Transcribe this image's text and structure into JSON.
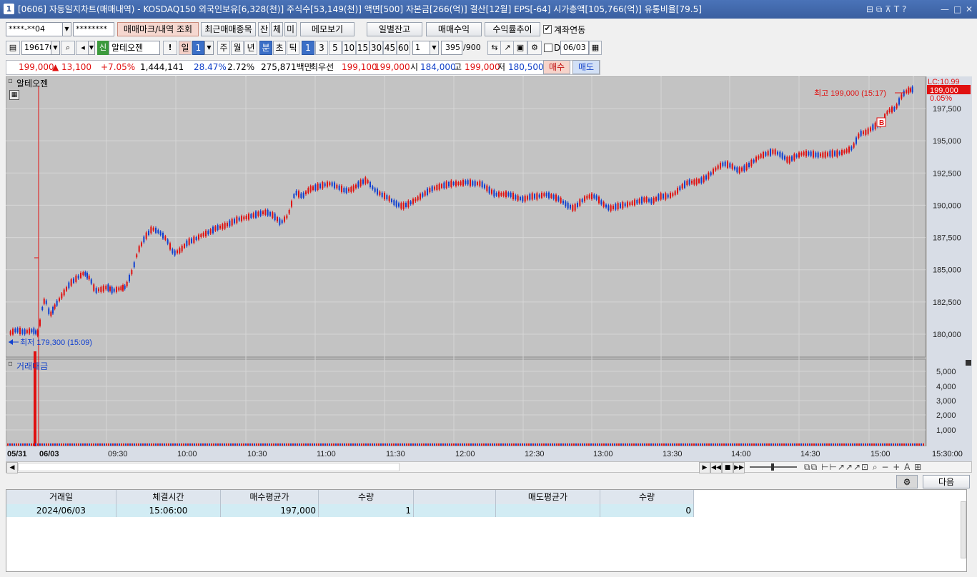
{
  "window": {
    "title": "[0606] 자동일지차트(매매내역) - KOSDAQ150 외국인보유[6,328(천)] 주식수[53,149(천)] 액면[500] 자본금[266(억)] 결산[12월] EPS[-64] 시가총액[105,766(억)] 유통비율[79.5]",
    "num": "1",
    "ctrl_icons": "⊟ ⧉ ⊼ T ?",
    "min": "—",
    "max": "□",
    "close": "✕"
  },
  "account": {
    "number": "****-**04",
    "password": "********"
  },
  "toolbar": {
    "btn_mark": "매매마크/내역 조회",
    "btn_recent": "최근매매종목",
    "btn_jan": "잔",
    "btn_che": "체",
    "btn_mi": "미",
    "btn_memo": "메모보기",
    "btn_daily": "일별잔고",
    "btn_profit": "매매수익",
    "btn_rate": "수익률추이",
    "chk_link": "계좌연동"
  },
  "toolbar2": {
    "code": "196170",
    "sin": "신",
    "name": "알테오젠",
    "excl": "!",
    "il": "일",
    "il_val": "1",
    "ju": "주",
    "wol": "월",
    "nyeon": "년",
    "bun": "분",
    "cho": "초",
    "tik": "틱",
    "m1": "1",
    "m3": "3",
    "m5": "5",
    "m10": "10",
    "m15": "15",
    "m30": "30",
    "m45": "45",
    "m60": "60",
    "interval": "1",
    "count": "395",
    "count_max": "/900",
    "d_label": "D",
    "date": "06/03"
  },
  "quote": {
    "price": "199,000",
    "change": "▲  13,100",
    "pct": "+7.05%",
    "volume": "1,444,141",
    "rate1": "28.47%",
    "rate2": "2.72%",
    "amount": "275,871백만",
    "best_label": "최우선",
    "best_ask": "199,100",
    "best_bid": "199,000",
    "open_label": "시",
    "open": "184,000",
    "high_label": "고",
    "high": "199,000",
    "low_label": "저",
    "low": "180,500",
    "buy": "매수",
    "sell": "매도"
  },
  "chart": {
    "name": "알테오젠",
    "current_price": "199,000",
    "lc": "LC:10.99",
    "pct": "0.05%",
    "high_label": "최고 199,000 (15:17)",
    "low_label": "최저 179,300 (15:09)",
    "buy_marker": "B",
    "sub_title": "거래대금",
    "yticks": [
      "197,500",
      "195,000",
      "192,500",
      "190,000",
      "187,500",
      "185,000",
      "182,500",
      "180,000"
    ],
    "vticks": [
      "5,000",
      "4,000",
      "3,000",
      "2,000",
      "1,000"
    ],
    "xticks": [
      "09:30",
      "10:00",
      "10:30",
      "11:00",
      "11:30",
      "12:00",
      "12:30",
      "13:00",
      "13:30",
      "14:00",
      "14:30",
      "15:00"
    ],
    "date_left": "05/31",
    "date_right": "06/03",
    "time_right": "15:30:00",
    "colors": {
      "up": "#e01010",
      "down": "#1040d0",
      "bg": "#c0c0c0"
    }
  },
  "bottom": {
    "settings": "⚙",
    "next": "다음"
  },
  "table": {
    "headers": [
      "거래일",
      "체결시간",
      "매수평균가",
      "수량",
      "",
      "매도평균가",
      "수량"
    ],
    "rows": [
      {
        "date": "2024/06/03",
        "time": "15:06:00",
        "buy_avg": "197,000",
        "buy_qty": "1",
        "blank": "",
        "sell_avg": "",
        "sell_qty": "0"
      }
    ]
  }
}
